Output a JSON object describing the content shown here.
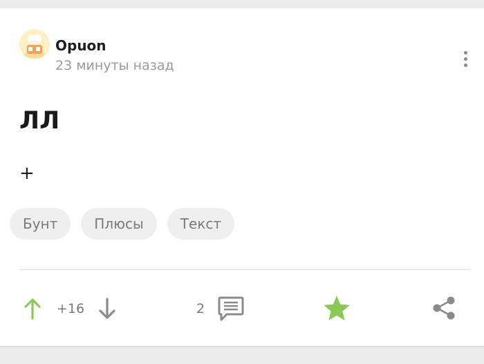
{
  "post": {
    "author": "Opuon",
    "time_ago": "23 минуты назад",
    "title": "ЛЛ",
    "body": "+",
    "tags": [
      "Бунт",
      "Плюсы",
      "Текст"
    ],
    "rating": "+16",
    "comments_count": "2"
  },
  "icons": {
    "upvote": "arrow-up-icon",
    "downvote": "arrow-down-icon",
    "comments": "comment-icon",
    "save": "star-icon",
    "share": "share-icon",
    "more": "more-vertical-icon"
  },
  "colors": {
    "accent_green": "#8ac858",
    "muted_icon": "#8a8a8a",
    "tag_background": "#efefef"
  }
}
